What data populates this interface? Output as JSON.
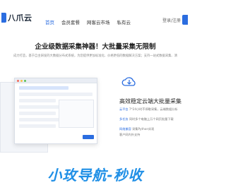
{
  "nav": {
    "logo_text": "八爪云",
    "links": [
      "首页",
      "会员套餐",
      "网客云市场",
      "私有云"
    ],
    "login": "登录/注册"
  },
  "hero": {
    "title": "企业级数据采集神器！大批量采集无限制",
    "subtitle": "成力打造，基于自主研发的大数据分布式系统，为您提供更加标准化、价格更低的数据解决方案；支持一站式数据采集、清"
  },
  "feature": {
    "title": "高效稳定云端大批量采集",
    "items": [
      {
        "label": "云平台",
        "text": "7*24小时不停歇采集，云端数据分析"
      },
      {
        "label": "多任务",
        "text": "同时多个电脑上万个网页批量下载"
      },
      {
        "label": "网络兼容",
        "text": "采集Python实现"
      },
      {
        "label": "",
        "text": "客户网内外支持"
      }
    ]
  },
  "watermark": "小玫导航-秒收",
  "colors": {
    "accent": "#2b6de0",
    "watermark": "#1f8fe6"
  }
}
